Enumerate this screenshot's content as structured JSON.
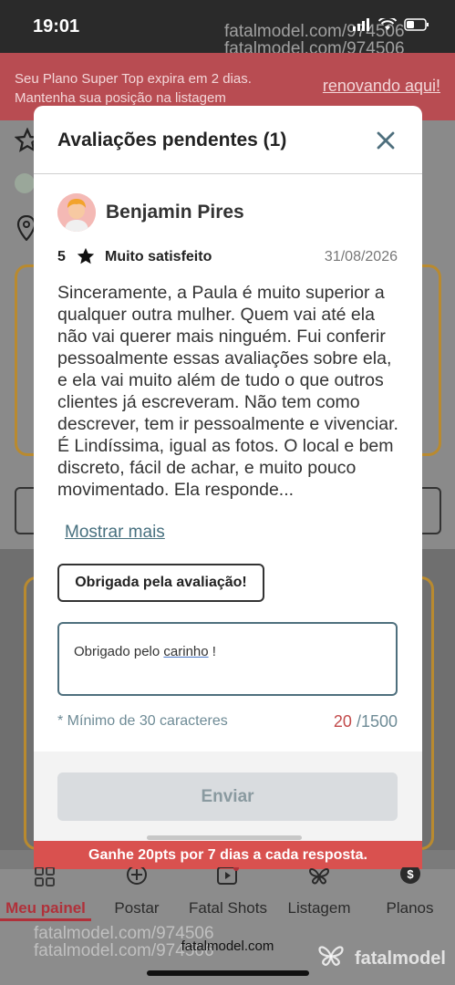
{
  "status_bar": {
    "time": "19:01"
  },
  "watermark": "fatalmodel.com/974506",
  "plan_banner": {
    "message_line1": "Seu Plano Super Top expira em 2 dias.",
    "message_line2": "Mantenha sua posição na listagem",
    "link": "renovando aqui!"
  },
  "modal": {
    "title": "Avaliações pendentes (1)",
    "reviewer_name": "Benjamin Pires",
    "rating_value": "5",
    "rating_label": "Muito satisfeito",
    "date": "31/08/2026",
    "review_text": "Sinceramente, a Paula é muito superior a qualquer outra mulher. Quem vai até ela não vai querer mais ninguém. Fui conferir pessoalmente essas avaliações sobre ela, e ela vai muito além de tudo o que outros clientes já escreveram. Não tem como descrever, tem ir pessoalmente e vivenciar. É Lindíssima, igual as fotos. O local e bem discreto, fácil de achar, e muito pouco movimentado. Ela responde...",
    "show_more": "Mostrar mais",
    "suggested_reply": "Obrigada pela avaliação!",
    "reply_prefix": "Obrigado pelo ",
    "reply_underlined": "carinho",
    "reply_suffix": " !",
    "min_hint": "* Mínimo de 30 caracteres",
    "char_count_current": "20",
    "char_count_max": "/1500",
    "send_label": "Enviar"
  },
  "promo": "Ganhe 20pts por 7 dias a cada resposta.",
  "nav": {
    "items": [
      {
        "label": "Meu painel",
        "icon": "dashboard-icon"
      },
      {
        "label": "Postar",
        "icon": "plus-circle-icon"
      },
      {
        "label": "Fatal Shots",
        "icon": "video-icon"
      },
      {
        "label": "Listagem",
        "icon": "butterfly-icon"
      },
      {
        "label": "Planos",
        "icon": "dollar-icon"
      }
    ]
  },
  "browser": {
    "url": "fatalmodel.com"
  },
  "brand": "fatalmodel",
  "colors": {
    "accent_red": "#d9514f",
    "banner_red": "#b84c52",
    "link_teal": "#47707f",
    "gold": "#b98a2f"
  }
}
